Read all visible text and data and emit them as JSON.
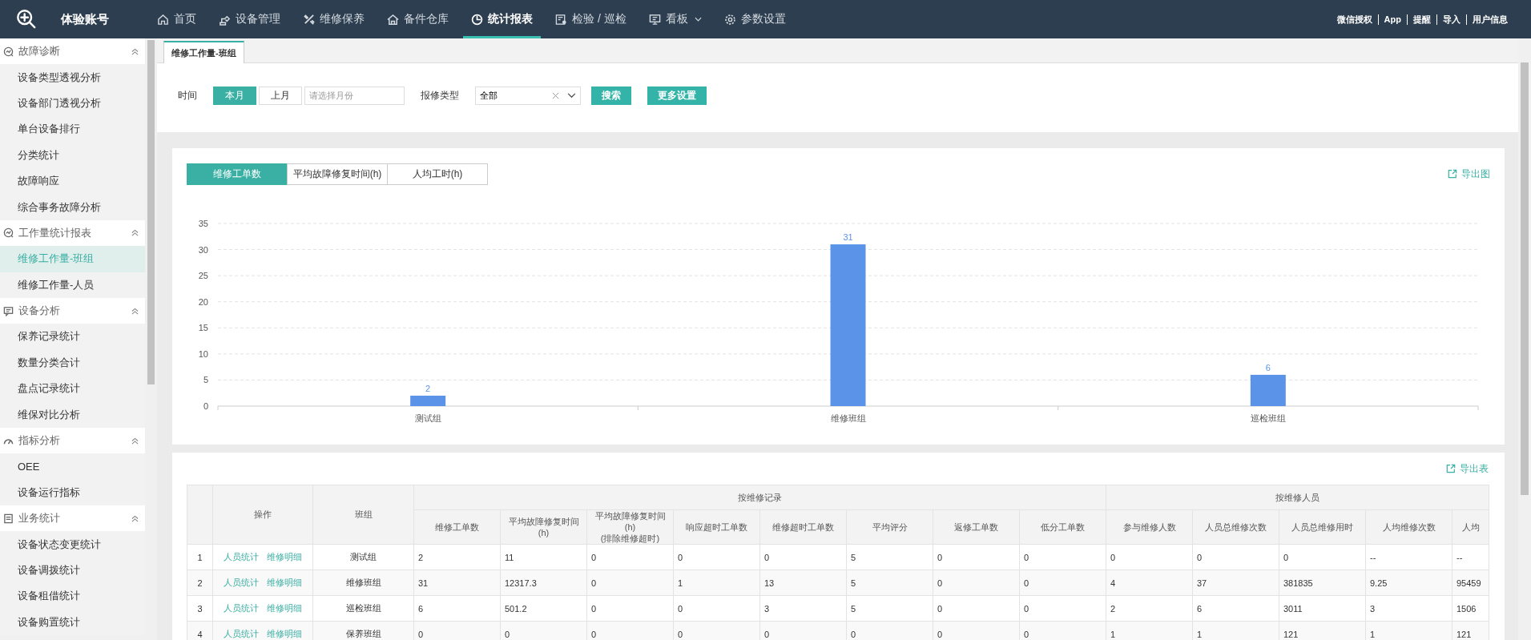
{
  "brand": {
    "title": "体验账号"
  },
  "nav": [
    {
      "label": "首页",
      "selected": false,
      "has_menu": false
    },
    {
      "label": "设备管理",
      "selected": false,
      "has_menu": false
    },
    {
      "label": "维修保养",
      "selected": false,
      "has_menu": false
    },
    {
      "label": "备件仓库",
      "selected": false,
      "has_menu": false
    },
    {
      "label": "统计报表",
      "selected": true,
      "has_menu": false
    },
    {
      "label": "检验 / 巡检",
      "selected": false,
      "has_menu": false
    },
    {
      "label": "看板",
      "selected": false,
      "has_menu": true
    },
    {
      "label": "参数设置",
      "selected": false,
      "has_menu": false
    }
  ],
  "user_links": [
    "微信授权",
    "App",
    "提醒",
    "导入",
    "用户信息"
  ],
  "sidebar": {
    "groups": [
      {
        "title": "故障诊断",
        "expanded": true,
        "items": [
          {
            "label": "设备类型透视分析",
            "selected": false
          },
          {
            "label": "设备部门透视分析",
            "selected": false
          },
          {
            "label": "单台设备排行",
            "selected": false
          },
          {
            "label": "分类统计",
            "selected": false
          },
          {
            "label": "故障响应",
            "selected": false
          },
          {
            "label": "综合事务故障分析",
            "selected": false
          }
        ]
      },
      {
        "title": "工作量统计报表",
        "expanded": true,
        "items": [
          {
            "label": "维修工作量-班组",
            "selected": true
          },
          {
            "label": "维修工作量-人员",
            "selected": false
          }
        ]
      },
      {
        "title": "设备分析",
        "expanded": true,
        "items": [
          {
            "label": "保养记录统计",
            "selected": false
          },
          {
            "label": "数量分类合计",
            "selected": false
          },
          {
            "label": "盘点记录统计",
            "selected": false
          },
          {
            "label": "维保对比分析",
            "selected": false
          }
        ]
      },
      {
        "title": "指标分析",
        "expanded": true,
        "items": [
          {
            "label": "OEE",
            "selected": false
          },
          {
            "label": "设备运行指标",
            "selected": false
          }
        ]
      },
      {
        "title": "业务统计",
        "expanded": true,
        "items": [
          {
            "label": "设备状态变更统计",
            "selected": false
          },
          {
            "label": "设备调拨统计",
            "selected": false
          },
          {
            "label": "设备租借统计",
            "selected": false
          },
          {
            "label": "设备购置统计",
            "selected": false
          }
        ]
      }
    ]
  },
  "page_tabs": [
    {
      "label": "维修工作量-班组",
      "selected": true
    }
  ],
  "filters": {
    "time_label": "时间",
    "time_buttons": [
      {
        "label": "本月",
        "selected": true
      },
      {
        "label": "上月",
        "selected": false
      }
    ],
    "month_placeholder": "请选择月份",
    "type_label": "报修类型",
    "type_value": "全部",
    "search": "搜索",
    "more": "更多设置"
  },
  "chart_card": {
    "tabs": [
      {
        "label": "维修工单数",
        "selected": true
      },
      {
        "label": "平均故障修复时间(h)",
        "selected": false
      },
      {
        "label": "人均工时(h)",
        "selected": false
      }
    ],
    "export": "导出图",
    "chart_data": {
      "type": "bar",
      "categories": [
        "测试组",
        "维修班组",
        "巡检班组"
      ],
      "series": [
        {
          "color": "#5b93e8",
          "values": [
            2,
            31,
            6
          ]
        }
      ],
      "grid": true,
      "ylim": [
        0,
        35
      ],
      "yticks": [
        0,
        5,
        10,
        15,
        20,
        25,
        30,
        35
      ],
      "data_labels": true
    }
  },
  "table_card": {
    "export": "导出表",
    "groups": [
      {
        "label": "按维修记录"
      },
      {
        "label": "按维修人员"
      }
    ],
    "fixed_columns": [
      "操作",
      "班组"
    ],
    "columns": [
      "维修工单数",
      "平均故障修复时间(h)",
      "平均故障修复时间(h)\n(排除维修超时)",
      "响应超时工单数",
      "维修超时工单数",
      "平均评分",
      "返修工单数",
      "低分工单数",
      "参与维修人数",
      "人员总维修次数",
      "人员总维修用时",
      "人均维修次数",
      "人均"
    ],
    "rows": [
      {
        "index": "1",
        "actions": [
          "人员统计",
          "维修明细"
        ],
        "team": "测试组",
        "values": [
          "2",
          "11",
          "0",
          "0",
          "0",
          "5",
          "0",
          "0",
          "0",
          "0",
          "0",
          "--",
          "--"
        ]
      },
      {
        "index": "2",
        "actions": [
          "人员统计",
          "维修明细"
        ],
        "team": "维修班组",
        "values": [
          "31",
          "12317.3",
          "0",
          "1",
          "13",
          "5",
          "0",
          "0",
          "4",
          "37",
          "381835",
          "9.25",
          "95459"
        ]
      },
      {
        "index": "3",
        "actions": [
          "人员统计",
          "维修明细"
        ],
        "team": "巡检班组",
        "values": [
          "6",
          "501.2",
          "0",
          "0",
          "3",
          "5",
          "0",
          "0",
          "2",
          "6",
          "3011",
          "3",
          "1506"
        ]
      },
      {
        "index": "4",
        "actions": [
          "人员统计",
          "维修明细"
        ],
        "team": "保养班组",
        "values": [
          "0",
          "0",
          "0",
          "0",
          "0",
          "0",
          "0",
          "0",
          "1",
          "1",
          "121",
          "1",
          "121"
        ]
      }
    ]
  }
}
